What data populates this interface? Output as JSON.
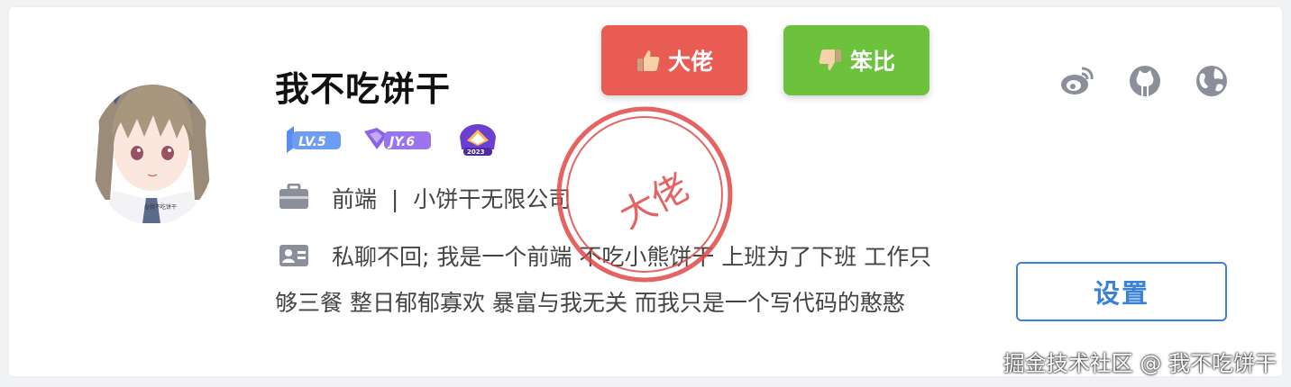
{
  "profile": {
    "name": "我不吃饼干",
    "badges": [
      {
        "label": "LV.5",
        "icon": "level-badge-icon"
      },
      {
        "label": "JY.6",
        "icon": "jy-badge-icon"
      },
      {
        "label": "2023",
        "icon": "annual-badge-icon"
      }
    ],
    "job": "前端  |  小饼干无限公司",
    "bio_line1": "私聊不回; 我是一个前端 不吃小熊饼干 上班为了下班 工作只",
    "bio_line2": "够三餐 整日郁郁寡欢 暴富与我无关 而我只是一个写代码的憨憨",
    "avatar_caption": "@我不吃饼干"
  },
  "actions": {
    "like_label": "大佬",
    "dislike_label": "笨比",
    "settings_label": "设置"
  },
  "stamp": {
    "text": "大佬"
  },
  "social": [
    "weibo-icon",
    "github-icon",
    "globe-icon"
  ],
  "watermark": "掘金技术社区 @ 我不吃饼干",
  "colors": {
    "like": "#e85c54",
    "dislike": "#6cc13d",
    "settings": "#3a81d9",
    "stamp": "#e04848",
    "icon": "#8a8f99"
  }
}
